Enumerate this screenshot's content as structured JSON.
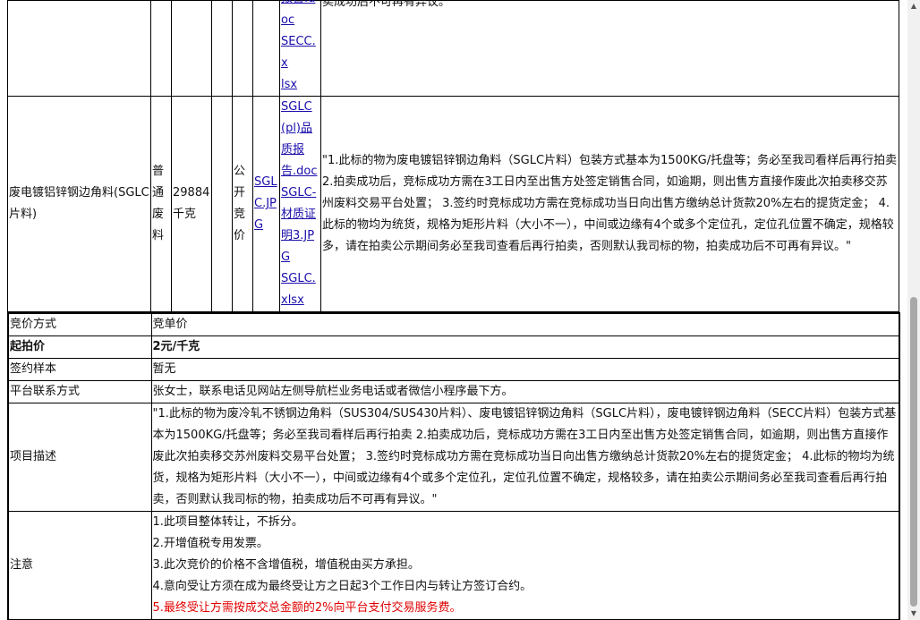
{
  "lots": [
    {
      "files": [
        "报告.d",
        "oc",
        "SECC.x",
        "lsx"
      ],
      "desc_tail": "卖成功后不可再有异议。\""
    },
    {
      "name": "废电镀铝锌钢边角料(SGLC片料)",
      "category": "普通废料",
      "quantity": "29884千克",
      "method": "公开竞价",
      "image": "SGLC.JPG",
      "files": [
        "SGLC(pl)品质报告.doc",
        "SGLC-材质证明3.JPG",
        "SGLC.xlsx"
      ],
      "desc": "\"1.此标的物为废电镀铝锌钢边角料（SGLC片料）包装方式基本为1500KG/托盘等；务必至我司看样后再行拍卖 2.拍卖成功后，竞标成功方需在3工日内至出售方处签定销售合同，如逾期，则出售方直接作废此次拍卖移交苏州废料交易平台处置； 3.签约时竞标成功方需在竞标成功当日向出售方缴纳总计货款20%左右的提货定金； 4.此标的物均为统货，规格为矩形片料（大小不一），中间或边缘有4个或多个定位孔，定位孔位置不确定，规格较多，请在拍卖公示期间务必至我司查看后再行拍卖，否则默认我司标的物，拍卖成功后不可再有异议。\""
    }
  ],
  "info": {
    "bid_method_label": "竞价方式",
    "bid_method_value": "竞单价",
    "start_price_label": "起拍价",
    "start_price_value": "2元/千克",
    "contract_label": "签约样本",
    "contract_value": "暂无",
    "contact_label": "平台联系方式",
    "contact_value": "张女士，联系电话见网站左侧导航栏业务电话或者微信小程序最下方。",
    "project_label": "项目描述",
    "project_value": "\"1.此标的物为废冷轧不锈钢边角料（SUS304/SUS430片料）、废电镀铝锌钢边角料（SGLC片料），废电镀锌钢边角料（SECC片料）包装方式基本为1500KG/托盘等；务必至我司看样后再行拍卖 2.拍卖成功后，竞标成功方需在3工日内至出售方处签定销售合同，如逾期，则出售方直接作废此次拍卖移交苏州废料交易平台处置； 3.签约时竞标成功方需在竞标成功当日向出售方缴纳总计货款20%左右的提货定金； 4.此标的物均为统货，规格为矩形片料（大小不一），中间或边缘有4个或多个定位孔，定位孔位置不确定，规格较多，请在拍卖公示期间务必至我司查看后再行拍卖，否则默认我司标的物，拍卖成功后不可再有异议。\"",
    "notes_label": "注意",
    "notes": [
      "1.此项目整体转让，不拆分。",
      "2.开增值税专用发票。",
      "3.此次竞价的价格不含增值税，增值税由买方承担。",
      "4.意向受让方须在成为最终受让方之日起3个工作日内与转让方签订合约。"
    ],
    "notes_red": "5.最终受让方需按成交总金额的2%向平台支付交易服务费。",
    "red_color": "#e00000"
  },
  "scrollbar": {
    "up_icon": "scroll-up-arrow-icon",
    "down_icon": "scroll-down-arrow-icon"
  }
}
